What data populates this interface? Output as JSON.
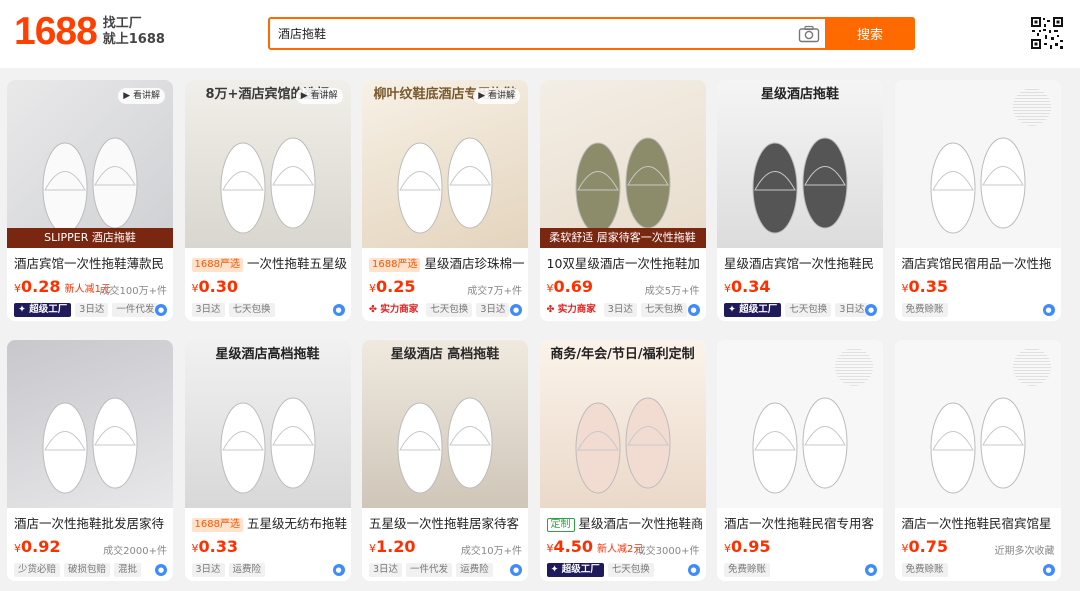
{
  "header": {
    "logo": "1688",
    "slogan1": "找工厂",
    "slogan2": "就上1688",
    "search_value": "酒店拖鞋",
    "search_button": "搜索",
    "camera_icon": "camera-icon",
    "qr_icon": "qr-code-icon"
  },
  "video_label": "看讲解",
  "products": [
    {
      "title": "酒店宾馆一次性拖鞋薄款民",
      "tag": "",
      "price": "0.28",
      "promo": "新人减1元",
      "sold": "成交100万+件",
      "badges": [
        "超级工厂",
        "3日达",
        "一件代发"
      ],
      "img_text": "SLIPPER 酒店拖鞋",
      "video": true
    },
    {
      "title": "一次性拖鞋五星级",
      "tag": "1688严选",
      "price": "0.30",
      "promo": "",
      "sold": "",
      "badges": [
        "3日达",
        "七天包换"
      ],
      "img_text": "8万+酒店宾馆的选择",
      "video": true
    },
    {
      "title": "星级酒店珍珠棉一",
      "tag": "1688严选",
      "price": "0.25",
      "promo": "",
      "sold": "成交7万+件",
      "badges": [
        "实力商家",
        "七天包换",
        "3日达"
      ],
      "img_text": "柳叶纹鞋底酒店专用拖鞋",
      "video": true
    },
    {
      "title": "10双星级酒店一次性拖鞋加",
      "tag": "",
      "price": "0.69",
      "promo": "",
      "sold": "成交5万+件",
      "badges": [
        "实力商家",
        "3日达",
        "七天包换"
      ],
      "img_text": "柔软舒适 居家待客一次性拖鞋",
      "video": false
    },
    {
      "title": "星级酒店宾馆一次性拖鞋民",
      "tag": "",
      "price": "0.34",
      "promo": "",
      "sold": "",
      "badges": [
        "超级工厂",
        "七天包换",
        "3日达"
      ],
      "img_text": "星级酒店拖鞋",
      "video": false
    },
    {
      "title": "酒店宾馆民宿用品一次性拖",
      "tag": "",
      "price": "0.35",
      "promo": "",
      "sold": "",
      "badges": [
        "免费赊账"
      ],
      "img_text": "",
      "video": false
    },
    {
      "title": "酒店一次性拖鞋批发居家待",
      "tag": "",
      "price": "0.92",
      "promo": "",
      "sold": "成交2000+件",
      "badges": [
        "少货必赔",
        "破损包赔",
        "混批"
      ],
      "img_text": "",
      "video": false
    },
    {
      "title": "五星级无纺布拖鞋",
      "tag": "1688严选",
      "price": "0.33",
      "promo": "",
      "sold": "",
      "badges": [
        "3日达",
        "运费险"
      ],
      "img_text": "星级酒店高档拖鞋",
      "video": false
    },
    {
      "title": "五星级一次性拖鞋居家待客",
      "tag": "",
      "price": "1.20",
      "promo": "",
      "sold": "成交10万+件",
      "badges": [
        "3日达",
        "一件代发",
        "运费险"
      ],
      "img_text": "星级酒店 高档拖鞋",
      "video": false
    },
    {
      "title": "星级酒店一次性拖鞋商",
      "tag": "定制",
      "price": "4.50",
      "promo": "新人减2元",
      "sold": "成交3000+件",
      "badges": [
        "超级工厂",
        "七天包换"
      ],
      "img_text": "商务/年会/节日/福利定制",
      "video": false
    },
    {
      "title": "酒店一次性拖鞋民宿专用客",
      "tag": "",
      "price": "0.95",
      "promo": "",
      "sold": "",
      "badges": [
        "免费赊账"
      ],
      "img_text": "",
      "video": false
    },
    {
      "title": "酒店一次性拖鞋民宿宾馆星",
      "tag": "",
      "price": "0.75",
      "promo": "",
      "sold": "近期多次收藏",
      "badges": [
        "免费赊账"
      ],
      "img_text": "",
      "video": false
    }
  ]
}
